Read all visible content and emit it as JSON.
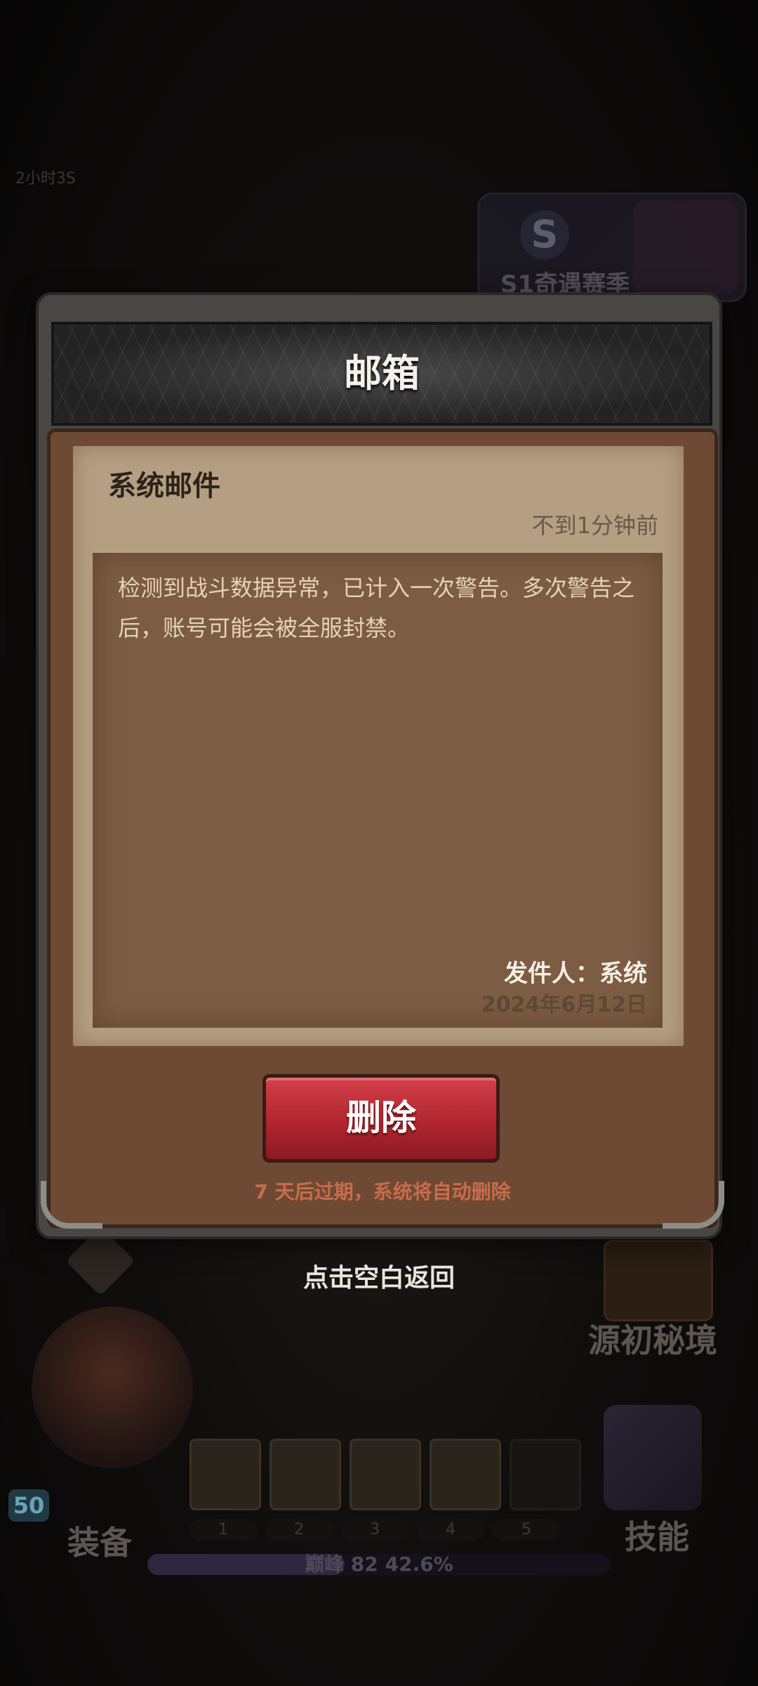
{
  "background": {
    "season_label": "S1奇遇赛季",
    "season_logo": "S",
    "bg_text": "2小时3S",
    "secret_realm_label": "源初秘境",
    "equipment_label": "装备",
    "skills_label": "技能",
    "hero_level": "50",
    "skill_slot_numbers": [
      "1",
      "2",
      "3",
      "4",
      "5"
    ],
    "exp_progress_text": "巅峰 82   42.6%",
    "exp_progress": 0.426
  },
  "dialog": {
    "title": "邮箱",
    "mail": {
      "title": "系统邮件",
      "time": "不到1分钟前",
      "content": "检测到战斗数据异常，已计入一次警告。多次警告之后，账号可能会被全服封禁。",
      "sender": "发件人：系统",
      "date": "2024年6月12日"
    },
    "delete_button": "删除",
    "expire_note": "7 天后过期，系统将自动删除"
  },
  "tap_to_return": "点击空白返回",
  "colors": {
    "delete_button": "#c0303a",
    "paper": "#b49f83",
    "content_box": "#7d5c44",
    "expire_note": "#c86c4c"
  }
}
